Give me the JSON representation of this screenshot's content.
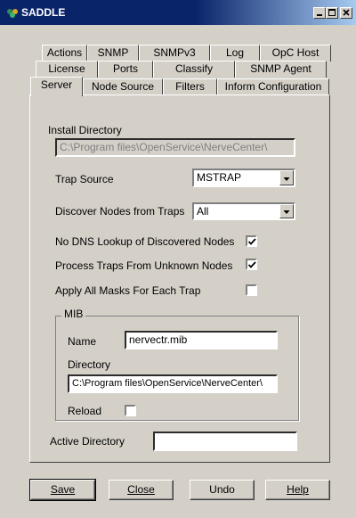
{
  "window": {
    "title": "SADDLE"
  },
  "tabs_row1": [
    "Actions",
    "SNMP",
    "SNMPv3",
    "Log",
    "OpC Host"
  ],
  "tabs_row2": [
    "License",
    "Ports",
    "Classify",
    "SNMP Agent"
  ],
  "tabs_row3": [
    "Server",
    "Node Source",
    "Filters",
    "Inform Configuration"
  ],
  "active_tab": "Server",
  "server": {
    "install_dir_label": "Install Directory",
    "install_dir_value": "C:\\Program files\\OpenService\\NerveCenter\\",
    "trap_source_label": "Trap Source",
    "trap_source_value": "MSTRAP",
    "discover_label": "Discover Nodes from Traps",
    "discover_value": "All",
    "no_dns_label": "No DNS Lookup of Discovered Nodes",
    "no_dns_checked": true,
    "process_traps_label": "Process Traps From Unknown Nodes",
    "process_traps_checked": true,
    "apply_masks_label": "Apply All Masks For Each Trap",
    "apply_masks_checked": false,
    "mib": {
      "group_label": "MIB",
      "name_label": "Name",
      "name_value": "nervectr.mib",
      "directory_label": "Directory",
      "directory_value": "C:\\Program files\\OpenService\\NerveCenter\\",
      "reload_label": "Reload",
      "reload_checked": false
    },
    "active_dir_label": "Active Directory",
    "active_dir_value": ""
  },
  "buttons": {
    "save": "Save",
    "close": "Close",
    "undo": "Undo",
    "help": "Help"
  },
  "colors": {
    "titlebar": "#0a246a",
    "face": "#d4d0c8"
  }
}
